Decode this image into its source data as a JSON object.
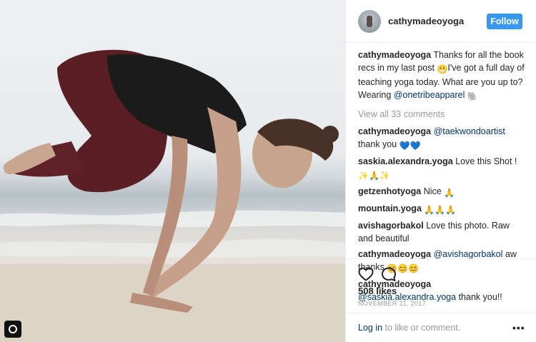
{
  "post": {
    "username": "cathymadeoyoga",
    "follow_label": "Follow",
    "caption_user": "cathymadeoyoga",
    "caption_text_1": "Thanks for all the book recs in my last post",
    "caption_text_2": "I've got a full day of teaching yoga today. What are you up to? Wearing",
    "caption_mention": "@onetribeapparel",
    "view_all": "View all 33 comments",
    "likes": "508 likes",
    "date": "NOVEMBER 11, 2017"
  },
  "comments": [
    {
      "user": "cathymadeoyoga",
      "mention": "@taekwondoartist",
      "text": "thank you"
    },
    {
      "user": "saskia.alexandra.yoga",
      "text": "Love this Shot !"
    },
    {
      "user": "getzenhotyoga",
      "text": "Nice"
    },
    {
      "user": "mountain.yoga",
      "text": ""
    },
    {
      "user": "avishagorbakol",
      "text": "Love this photo. Raw and beautiful"
    },
    {
      "user": "cathymadeoyoga",
      "mention": "@avishagorbakol",
      "text": "aw thanks"
    },
    {
      "user": "cathymadeoyoga",
      "mention": "@saskia.alexandra.yoga",
      "text": "thank you!!"
    }
  ],
  "footer": {
    "login_link": "Log in",
    "login_text": "to like or comment.",
    "more": "•••"
  },
  "icons": [
    "heart-icon",
    "comment-icon",
    "gallery-icon",
    "more-options-icon"
  ],
  "colors": {
    "follow_bg": "#3897f0",
    "link": "#003569",
    "muted": "#999999"
  }
}
